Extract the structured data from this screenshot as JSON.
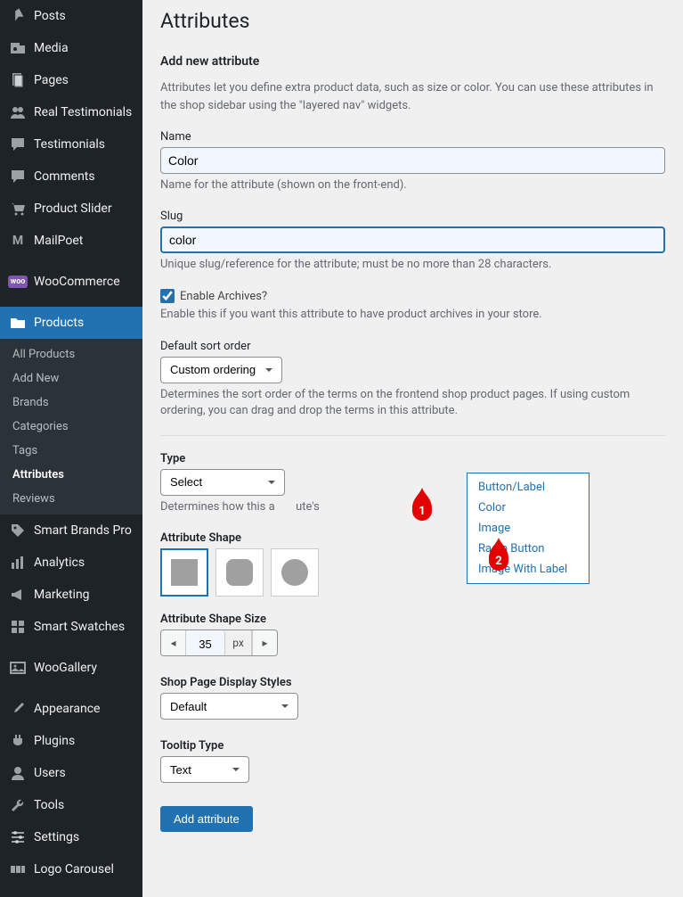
{
  "sidebar": {
    "items": [
      {
        "label": "Posts",
        "icon": "pin"
      },
      {
        "label": "Media",
        "icon": "media"
      },
      {
        "label": "Pages",
        "icon": "page"
      },
      {
        "label": "Real Testimonials",
        "icon": "people"
      },
      {
        "label": "Testimonials",
        "icon": "bubble"
      },
      {
        "label": "Comments",
        "icon": "comment"
      },
      {
        "label": "Product Slider",
        "icon": "cart"
      },
      {
        "label": "MailPoet",
        "icon": "m"
      },
      {
        "label": "WooCommerce",
        "icon": "woo"
      },
      {
        "label": "Products",
        "icon": "folder",
        "active": true
      },
      {
        "label": "Smart Brands Pro",
        "icon": "tag"
      },
      {
        "label": "Analytics",
        "icon": "chart"
      },
      {
        "label": "Marketing",
        "icon": "mega"
      },
      {
        "label": "Smart Swatches",
        "icon": "swatches"
      },
      {
        "label": "WooGallery",
        "icon": "gallery"
      },
      {
        "label": "Appearance",
        "icon": "brush"
      },
      {
        "label": "Plugins",
        "icon": "plug"
      },
      {
        "label": "Users",
        "icon": "user"
      },
      {
        "label": "Tools",
        "icon": "wrench"
      },
      {
        "label": "Settings",
        "icon": "sliders"
      },
      {
        "label": "Logo Carousel",
        "icon": "logo"
      }
    ],
    "submenu": [
      {
        "label": "All Products"
      },
      {
        "label": "Add New"
      },
      {
        "label": "Brands"
      },
      {
        "label": "Categories"
      },
      {
        "label": "Tags"
      },
      {
        "label": "Attributes",
        "active": true
      },
      {
        "label": "Reviews"
      }
    ]
  },
  "page": {
    "title": "Attributes",
    "form_heading": "Add new attribute",
    "intro": "Attributes let you define extra product data, such as size or color. You can use these attributes in the shop sidebar using the \"layered nav\" widgets.",
    "name_label": "Name",
    "name_value": "Color",
    "name_desc": "Name for the attribute (shown on the front-end).",
    "slug_label": "Slug",
    "slug_value": "color",
    "slug_desc": "Unique slug/reference for the attribute; must be no more than 28 characters.",
    "archives_label": "Enable Archives?",
    "archives_desc": "Enable this if you want this attribute to have product archives in your store.",
    "sort_label": "Default sort order",
    "sort_value": "Custom ordering",
    "sort_desc": "Determines the sort order of the terms on the frontend shop product pages. If using custom ordering, you can drag and drop the terms in this attribute.",
    "type_label": "Type",
    "type_value": "Select",
    "type_desc_partial": "Determines how this a",
    "type_desc_partial2": "ute's",
    "type_options": [
      "Button/Label",
      "Color",
      "Image",
      "Radio Button",
      "Image With Label"
    ],
    "shape_label": "Attribute Shape",
    "shape_size_label": "Attribute Shape Size",
    "shape_size_value": "35",
    "shape_size_unit": "px",
    "display_label": "Shop Page Display Styles",
    "display_value": "Default",
    "tooltip_label": "Tooltip Type",
    "tooltip_value": "Text",
    "submit": "Add attribute"
  },
  "callouts": {
    "c1": "1",
    "c2": "2"
  }
}
